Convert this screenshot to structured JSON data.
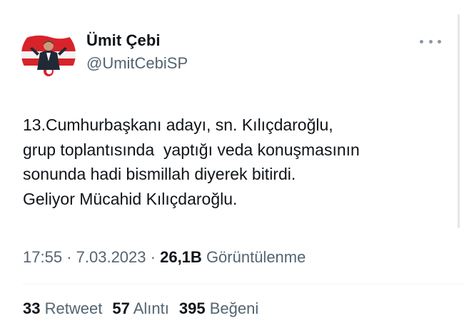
{
  "author": {
    "display_name": "Ümit Çebi",
    "handle": "@UmitCebiSP"
  },
  "icons": {
    "avatar": "profile-photo",
    "more": "more-options-icon"
  },
  "tweet": {
    "lines": [
      "13.Cumhurbaşkanı adayı, sn. Kılıçdaroğlu,",
      "grup toplantısında  yaptığı veda konuşmasının",
      "sonunda hadi bismillah diyerek bitirdi.",
      "Geliyor Mücahid Kılıçdaroğlu."
    ]
  },
  "meta": {
    "time": "17:55",
    "separator": "·",
    "date": "7.03.2023",
    "views_count": "26,1B",
    "views_label": "Görüntülenme"
  },
  "stats": {
    "retweets_count": "33",
    "retweets_label": "Retweet",
    "quotes_count": "57",
    "quotes_label": "Alıntı",
    "likes_count": "395",
    "likes_label": "Beğeni"
  },
  "colors": {
    "text_primary": "#0f1419",
    "text_secondary": "#536471",
    "divider": "#eff3f4",
    "avatar_accent": "#d8232a"
  }
}
